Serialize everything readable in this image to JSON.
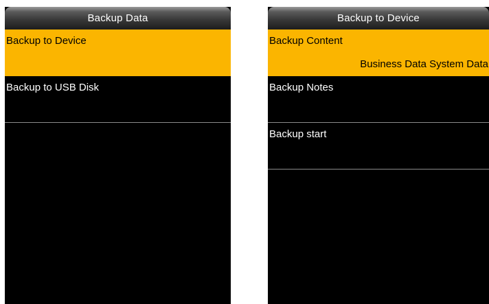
{
  "left_screen": {
    "title": "Backup Data",
    "items": [
      {
        "label": "Backup to Device",
        "selected": true
      },
      {
        "label": "Backup to USB Disk",
        "selected": false
      }
    ]
  },
  "right_screen": {
    "title": "Backup to Device",
    "items": [
      {
        "label": "Backup Content",
        "value": "Business Data System Data",
        "selected": true
      },
      {
        "label": "Backup Notes",
        "value": "",
        "selected": false
      },
      {
        "label": "Backup start",
        "value": "",
        "selected": false
      }
    ]
  },
  "colors": {
    "highlight": "#fbb500",
    "background": "#000000",
    "text": "#ffffff",
    "divider": "#8c8c8c"
  }
}
